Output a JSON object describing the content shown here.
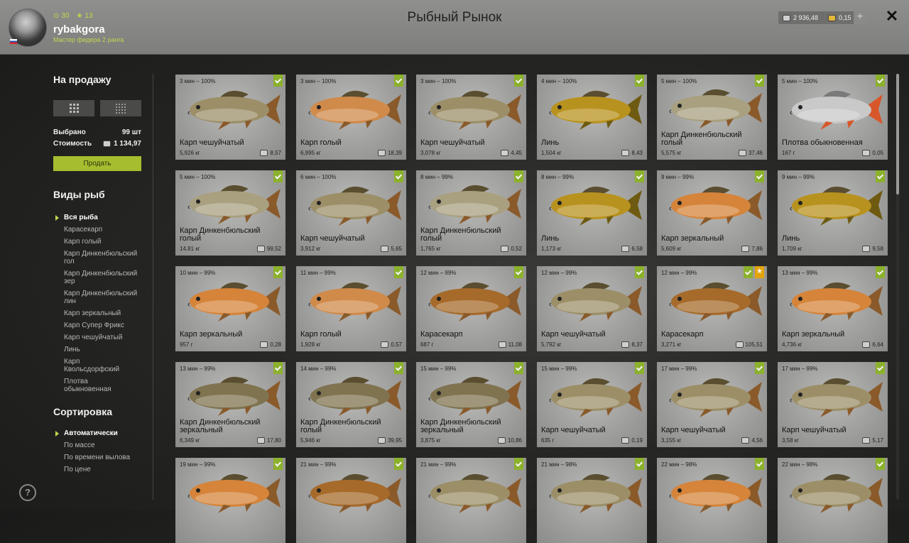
{
  "header": {
    "title": "Рыбный Рынок",
    "username": "rybakgora",
    "rank": "Мастер фидера 2 ранга",
    "level": "30",
    "stars": "13",
    "silver": "2 936,48",
    "gold": "0,15",
    "plus_label": "+",
    "close_label": "✕"
  },
  "sidebar": {
    "for_sale_title": "На продажу",
    "selected_label": "Выбрано",
    "selected_value": "99 шт",
    "cost_label": "Стоимость",
    "cost_value": "1 134,97",
    "sell_button": "Продать",
    "fish_types_title": "Виды рыб",
    "fish_types": [
      "Вся рыба",
      "Карасекарп",
      "Карп голый",
      "Карп Динкенбюльский гол",
      "Карп Динкенбюльский зер",
      "Карп Динкенбюльский лин",
      "Карп зеркальный",
      "Карп Супер Фрикс",
      "Карп чешуйчатый",
      "Линь",
      "Карп Квольсдорфский",
      "Плотва обыкновенная"
    ],
    "sort_title": "Сортировка",
    "sort_options": [
      "Автоматически",
      "По массе",
      "По времени вылова",
      "По цене"
    ],
    "help_label": "?"
  },
  "cards": [
    {
      "time": "3 мин – 100%",
      "name": "Карп чешуйчатый",
      "weight": "5,926 кг",
      "price": "8,57",
      "kind": "scaly"
    },
    {
      "time": "3 мин – 100%",
      "name": "Карп голый",
      "weight": "6,995 кг",
      "price": "18,39",
      "kind": "leather"
    },
    {
      "time": "3 мин – 100%",
      "name": "Карп чешуйчатый",
      "weight": "3,078 кг",
      "price": "4,45",
      "kind": "scaly"
    },
    {
      "time": "4 мин – 100%",
      "name": "Линь",
      "weight": "1,504 кг",
      "price": "8,43",
      "kind": "tench"
    },
    {
      "time": "5 мин – 100%",
      "name": "Карп Динкенбюльский голый",
      "weight": "5,575 кг",
      "price": "37,46",
      "kind": "dink"
    },
    {
      "time": "5 мин – 100%",
      "name": "Плотва обыкновенная",
      "weight": "167 г",
      "price": "0,05",
      "kind": "roach"
    },
    {
      "time": "5 мин – 100%",
      "name": "Карп Динкенбюльский голый",
      "weight": "14,81 кг",
      "price": "99,52",
      "kind": "dink"
    },
    {
      "time": "6 мин – 100%",
      "name": "Карп чешуйчатый",
      "weight": "3,912 кг",
      "price": "5,65",
      "kind": "scaly"
    },
    {
      "time": "8 мин – 99%",
      "name": "Карп Динкенбюльский голый",
      "weight": "1,765 кг",
      "price": "0,52",
      "kind": "dink"
    },
    {
      "time": "8 мин – 99%",
      "name": "Линь",
      "weight": "1,173 кг",
      "price": "6,58",
      "kind": "tench"
    },
    {
      "time": "9 мин – 99%",
      "name": "Карп зеркальный",
      "weight": "5,609 кг",
      "price": "7,86",
      "kind": "mirror"
    },
    {
      "time": "9 мин – 99%",
      "name": "Линь",
      "weight": "1,709 кг",
      "price": "9,58",
      "kind": "tench"
    },
    {
      "time": "10 мин – 99%",
      "name": "Карп зеркальный",
      "weight": "957 г",
      "price": "0,28",
      "kind": "mirror"
    },
    {
      "time": "11 мин – 99%",
      "name": "Карп голый",
      "weight": "1,928 кг",
      "price": "0,57",
      "kind": "leather"
    },
    {
      "time": "12 мин – 99%",
      "name": "Карасекарп",
      "weight": "687 г",
      "price": "11,08",
      "kind": "crucian"
    },
    {
      "time": "12 мин – 99%",
      "name": "Карп чешуйчатый",
      "weight": "5,792 кг",
      "price": "8,37",
      "kind": "scaly"
    },
    {
      "time": "12 мин – 99%",
      "name": "Карасекарп",
      "weight": "3,271 кг",
      "price": "105,51",
      "kind": "crucian",
      "star": true
    },
    {
      "time": "13 мин – 99%",
      "name": "Карп зеркальный",
      "weight": "4,736 кг",
      "price": "6,64",
      "kind": "mirror"
    },
    {
      "time": "13 мин – 99%",
      "name": "Карп Динкенбюльский зеркальный",
      "weight": "6,349 кг",
      "price": "17,80",
      "kind": "dinkscaly"
    },
    {
      "time": "14 мин – 99%",
      "name": "Карп Динкенбюльский голый",
      "weight": "5,946 кг",
      "price": "39,95",
      "kind": "dinkscaly"
    },
    {
      "time": "15 мин – 99%",
      "name": "Карп Динкенбюльский зеркальный",
      "weight": "3,875 кг",
      "price": "10,86",
      "kind": "dinkscaly"
    },
    {
      "time": "15 мин – 99%",
      "name": "Карп чешуйчатый",
      "weight": "635 г",
      "price": "0,19",
      "kind": "scaly"
    },
    {
      "time": "17 мин – 99%",
      "name": "Карп чешуйчатый",
      "weight": "3,155 кг",
      "price": "4,56",
      "kind": "scaly"
    },
    {
      "time": "17 мин – 99%",
      "name": "Карп чешуйчатый",
      "weight": "3,58 кг",
      "price": "5,17",
      "kind": "scaly"
    },
    {
      "time": "19 мин – 99%",
      "name": "",
      "weight": "",
      "price": "",
      "kind": "mirror"
    },
    {
      "time": "21 мин – 99%",
      "name": "",
      "weight": "",
      "price": "",
      "kind": "crucian"
    },
    {
      "time": "21 мин – 99%",
      "name": "",
      "weight": "",
      "price": "",
      "kind": "scaly"
    },
    {
      "time": "21 мин – 98%",
      "name": "",
      "weight": "",
      "price": "",
      "kind": "scaly"
    },
    {
      "time": "22 мин – 98%",
      "name": "",
      "weight": "",
      "price": "",
      "kind": "mirror"
    },
    {
      "time": "22 мин – 98%",
      "name": "",
      "weight": "",
      "price": "",
      "kind": "scaly"
    }
  ],
  "colors": {
    "accent": "#a6bd2f",
    "badge": "#8cb12c",
    "star_badge": "#e3a40b",
    "fish_scaly": "#9c8f68",
    "fish_leather": "#d08a4a",
    "fish_tench": "#b8921e",
    "fish_dink": "#a9a080",
    "fish_roach": "#c9c9c9",
    "fish_mirror": "#d5843a",
    "fish_crucian": "#a66a2a",
    "fish_dinkscaly": "#7f7350"
  }
}
